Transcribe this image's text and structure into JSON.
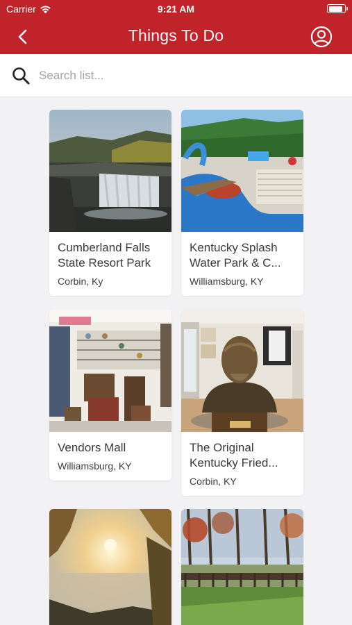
{
  "status_bar": {
    "carrier": "Carrier",
    "time": "9:21 AM",
    "battery_level": 0.9
  },
  "nav": {
    "title": "Things To Do"
  },
  "search": {
    "placeholder": "Search list..."
  },
  "colors": {
    "brand": "#c1232b",
    "background": "#f2f2f4"
  },
  "cards": [
    {
      "title": "Cumberland Falls State Resort Park",
      "subtitle": "Corbin, Ky"
    },
    {
      "title": "Kentucky Splash Water Park & C...",
      "subtitle": "Williamsburg, KY"
    },
    {
      "title": "Vendors Mall",
      "subtitle": "Williamsburg, KY"
    },
    {
      "title": "The Original Kentucky Fried...",
      "subtitle": "Corbin, KY"
    },
    {
      "title": "",
      "subtitle": ""
    },
    {
      "title": "",
      "subtitle": ""
    }
  ]
}
